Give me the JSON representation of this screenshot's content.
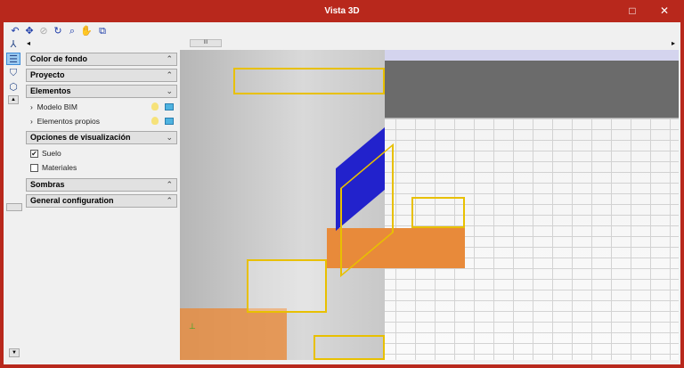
{
  "window": {
    "title": "Vista 3D",
    "maximize_icon": "□",
    "close_icon": "✕"
  },
  "toolbar": [
    {
      "name": "rotate-icon",
      "glyph": "↶"
    },
    {
      "name": "zoom-all-icon",
      "glyph": "✥"
    },
    {
      "name": "zoom-disabled-icon",
      "glyph": "⊘"
    },
    {
      "name": "refresh-icon",
      "glyph": "↻"
    },
    {
      "name": "zoom-window-icon",
      "glyph": "⌕"
    },
    {
      "name": "pan-hand-icon",
      "glyph": "✋"
    },
    {
      "name": "fit-view-icon",
      "glyph": "⧉"
    }
  ],
  "panel": {
    "sections": {
      "color_fondo": "Color de fondo",
      "proyecto": "Proyecto",
      "elementos": "Elementos",
      "opciones": "Opciones de visualización",
      "sombras": "Sombras",
      "general": "General configuration"
    },
    "elementos_items": [
      "Modelo BIM",
      "Elementos propios"
    ],
    "opciones_items": [
      {
        "label": "Suelo",
        "checked": true
      },
      {
        "label": "Materiales",
        "checked": false
      }
    ]
  },
  "scrollbar": {
    "grip": "III",
    "left_arrow": "◂",
    "right_arrow": "▸"
  }
}
